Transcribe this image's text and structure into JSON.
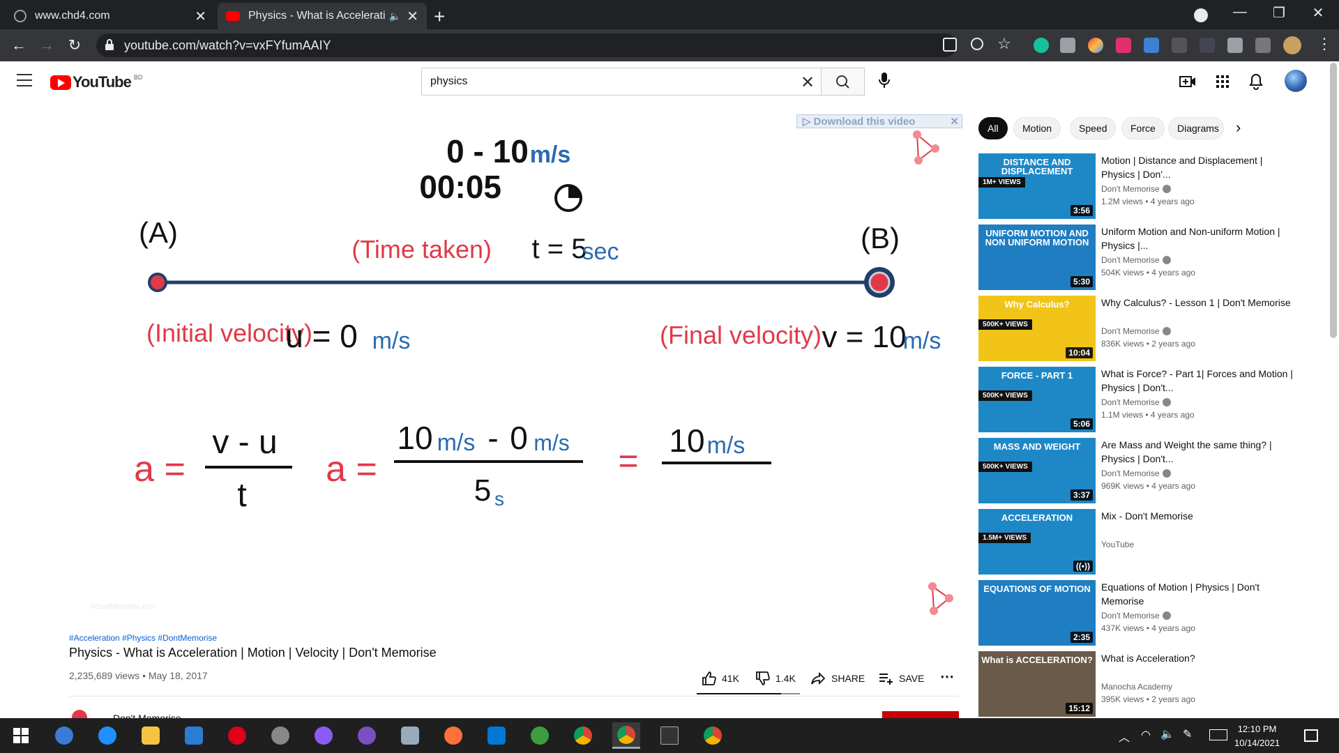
{
  "browser": {
    "tabs": [
      {
        "title": "www.chd4.com"
      },
      {
        "title": "Physics - What is Acceleratio"
      }
    ],
    "url": "youtube.com/watch?v=vxFYfumAAIY"
  },
  "youtube": {
    "logo_text": "YouTube",
    "country_code": "BD",
    "search_value": "physics"
  },
  "video": {
    "download_banner": "Download this video",
    "speed_range": "0 - 10",
    "speed_unit": "m/s",
    "timer": "00:05",
    "point_a": "(A)",
    "point_b": "(B)",
    "time_taken_label": "(Time taken)",
    "time_eq": "t = 5",
    "time_unit": "sec",
    "initial_label": "(Initial velocity)",
    "initial_eq": "u = 0",
    "final_label": "(Final velocity)",
    "final_eq": "v = 10",
    "vel_unit": "m/s",
    "formula_a": "a =",
    "formula_num": "v - u",
    "formula_den": "t",
    "formula2_a": "a =",
    "formula2_num_10": "10",
    "formula2_minus": "-",
    "formula2_num_0": "0",
    "formula2_den": "5",
    "formula2_den_unit": "s",
    "formula3_eq": "=",
    "formula3_num": "10",
    "watermark": "©DontMemorise.com"
  },
  "details": {
    "hashtags": "#Acceleration #Physics #DontMemorise",
    "title": "Physics - What is Acceleration | Motion | Velocity | Don't Memorise",
    "meta": "2,235,689 views • May 18, 2017",
    "likes": "41K",
    "dislikes": "1.4K",
    "share": "SHARE",
    "save": "SAVE",
    "like_ratio": 0.82,
    "channel_partial": "Don't Memorise"
  },
  "chips": [
    "All",
    "Motion",
    "Speed",
    "Force",
    "Diagrams"
  ],
  "recommendations": [
    {
      "title": "Motion | Distance and Displacement | Physics | Don'...",
      "channel": "Don't Memorise",
      "verified": true,
      "meta": "1.2M views • 4 years ago",
      "duration": "3:56",
      "thumb_text": "DISTANCE AND DISPLACEMENT",
      "thumb_badge": "1M+ VIEWS",
      "thumb_color": "#1e88c7"
    },
    {
      "title": "Uniform Motion and Non-uniform Motion | Physics |...",
      "channel": "Don't Memorise",
      "verified": true,
      "meta": "504K views • 4 years ago",
      "duration": "5:30",
      "thumb_text": "UNIFORM MOTION AND NON UNIFORM MOTION",
      "thumb_badge": "",
      "thumb_color": "#1f7dc2"
    },
    {
      "title": "Why Calculus? - Lesson 1 | Don't Memorise",
      "channel": "Don't Memorise",
      "verified": true,
      "meta": "836K views • 2 years ago",
      "duration": "10:04",
      "thumb_text": "Why Calculus?",
      "thumb_badge": "500K+ VIEWS",
      "thumb_color": "#f2c418"
    },
    {
      "title": "What is Force? - Part 1| Forces and Motion | Physics | Don't...",
      "channel": "Don't Memorise",
      "verified": true,
      "meta": "1.1M views • 4 years ago",
      "duration": "5:06",
      "thumb_text": "FORCE - PART 1",
      "thumb_badge": "500K+ VIEWS",
      "thumb_color": "#1e88c7"
    },
    {
      "title": "Are Mass and Weight the same thing? | Physics | Don't...",
      "channel": "Don't Memorise",
      "verified": true,
      "meta": "969K views • 4 years ago",
      "duration": "3:37",
      "thumb_text": "MASS AND WEIGHT",
      "thumb_badge": "500K+ VIEWS",
      "thumb_color": "#1e88c7"
    },
    {
      "title": "Mix - Don't Memorise",
      "channel": "YouTube",
      "verified": false,
      "meta": "",
      "duration": "",
      "thumb_text": "ACCELERATION",
      "thumb_badge": "1.5M+ VIEWS",
      "thumb_color": "#1e88c7"
    },
    {
      "title": "Equations of Motion | Physics | Don't Memorise",
      "channel": "Don't Memorise",
      "verified": true,
      "meta": "437K views • 4 years ago",
      "duration": "2:35",
      "thumb_text": "EQUATIONS OF MOTION",
      "thumb_badge": "",
      "thumb_color": "#1f7dc2"
    },
    {
      "title": "What is Acceleration?",
      "channel": "Manocha Academy",
      "verified": false,
      "meta": "395K views • 2 years ago",
      "duration": "15:12",
      "thumb_text": "What is ACCELERATION?",
      "thumb_badge": "",
      "thumb_color": "#6a5a4a"
    }
  ],
  "taskbar": {
    "time": "12:10 PM",
    "date": "10/14/2021"
  },
  "colors": {
    "red": "#e03a48",
    "blue": "#2a6ab0",
    "navy": "#1f3f6a"
  }
}
